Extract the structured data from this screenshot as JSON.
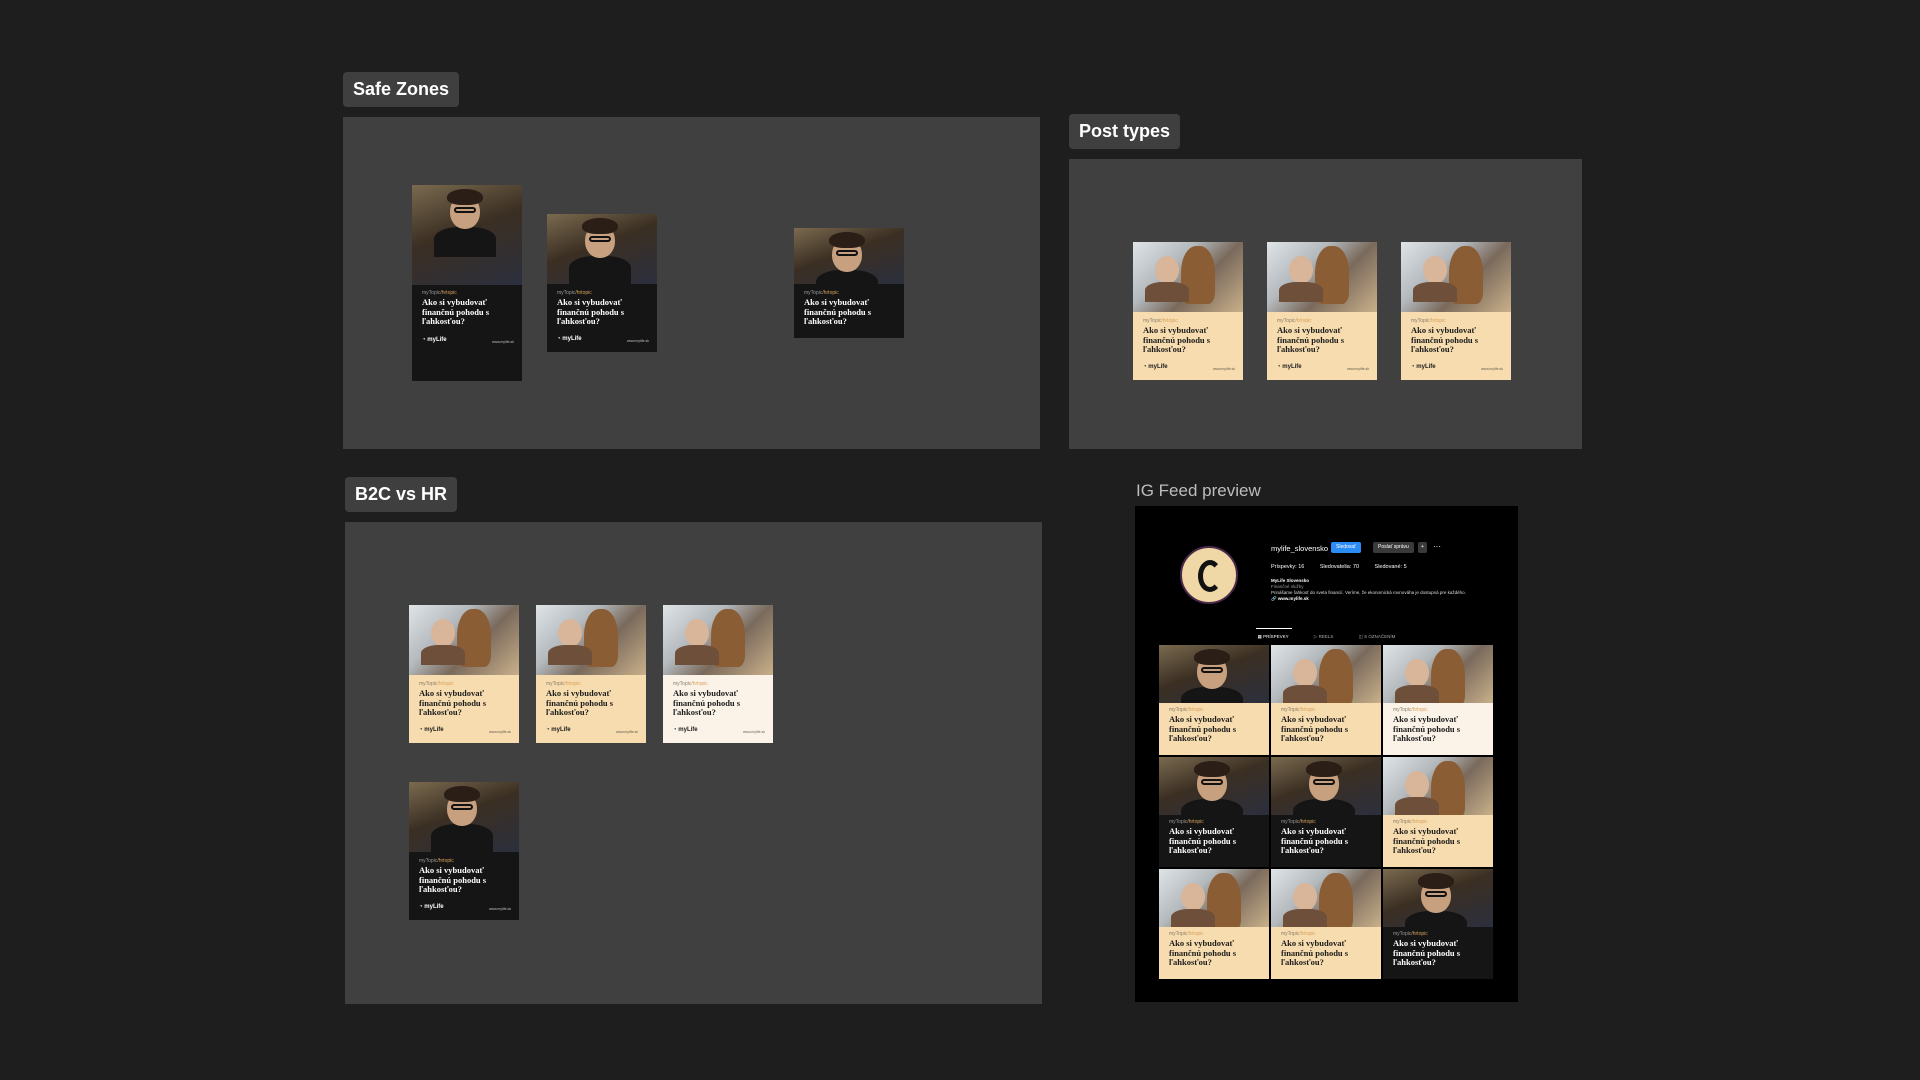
{
  "sections": {
    "safe_zones": "Safe Zones",
    "post_types": "Post types",
    "b2c_vs_hr": "B2C vs HR",
    "ig_feed_preview": "IG Feed preview"
  },
  "post": {
    "tag_prefix": "myTopic",
    "tag_suffix": "/hrtopic",
    "headline": "Ako si vybudovať finančnú pohodu s ľahkosťou?",
    "logo": "myLife",
    "website": "www.mylife.sk"
  },
  "ig": {
    "username": "mylife_slovensko",
    "follow_label": "Sledovať",
    "message_label": "Poslať správu",
    "add_label": "+",
    "more_label": "···",
    "posts_label": "Príspevky: 16",
    "followers_label": "Sledovatelia: 70",
    "following_label": "Sledované: 5",
    "bio_name": "MyLife Slovensko",
    "bio_category": "Finančné služby",
    "bio_text": "Prinášame ľahkosť do sveta financií. Veríme, že ekonomická rovnováha je dostupná pre každého.",
    "bio_link": "🔗 www.mylife.sk",
    "tab_posts": "▦ PRÍSPEVKY",
    "tab_reels": "▷ REELS",
    "tab_tagged": "◫ S OZNAČENÍM"
  },
  "colors": {
    "background": "#1e1e1e",
    "frame": "#404040",
    "dark_post": "#151515",
    "peach_post": "#f6dcae",
    "cream_post": "#fbf3e8",
    "ig_follow": "#2b8cf5"
  }
}
